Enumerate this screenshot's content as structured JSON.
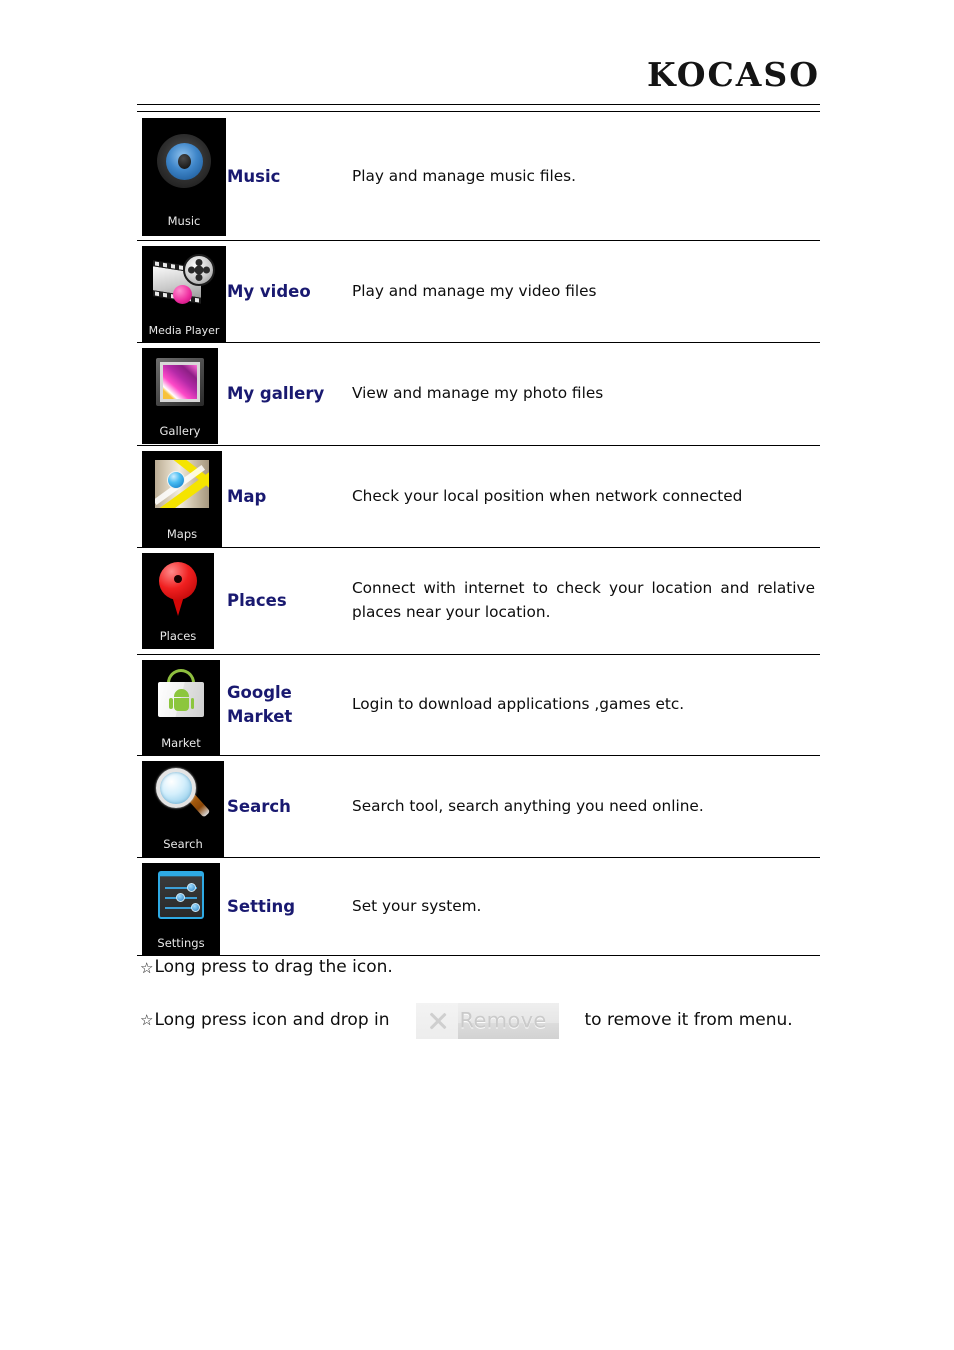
{
  "header": {
    "brand": "KOCASO"
  },
  "table": {
    "rows": [
      {
        "icon_name": "music-icon",
        "tile_label": "Music",
        "name": "Music",
        "desc": "Play and manage music files.",
        "justify": false
      },
      {
        "icon_name": "media-player-icon",
        "tile_label": "Media Player",
        "name": "My video",
        "desc": "Play and manage my video files",
        "justify": false
      },
      {
        "icon_name": "gallery-icon",
        "tile_label": "Gallery",
        "name": "My gallery",
        "desc": "View and manage my photo files",
        "justify": false
      },
      {
        "icon_name": "maps-icon",
        "tile_label": "Maps",
        "name": "Map",
        "desc": "Check your local position when network connected",
        "justify": false
      },
      {
        "icon_name": "places-icon",
        "tile_label": "Places",
        "name": "Places",
        "desc": "Connect with internet to check your location and relative places near your location.",
        "justify": true
      },
      {
        "icon_name": "market-icon",
        "tile_label": "Market",
        "name": "Google Market",
        "desc": "Login to download applications ,games etc.",
        "justify": false
      },
      {
        "icon_name": "search-icon",
        "tile_label": "Search",
        "name": "Search",
        "desc": "Search tool, search anything you need online.",
        "justify": false
      },
      {
        "icon_name": "settings-icon",
        "tile_label": "Settings",
        "name": "Setting",
        "desc": "Set your system.",
        "justify": false
      }
    ]
  },
  "notes": {
    "star": "☆",
    "line1": "Long press to drag the icon.",
    "line2_before": "Long press icon and drop in",
    "remove_label": "Remove",
    "line2_after": "to remove it from menu."
  },
  "colors": {
    "name_blue": "#191970",
    "tile_bg": "#000000",
    "text": "#0d0d0d",
    "rule": "#000000"
  }
}
